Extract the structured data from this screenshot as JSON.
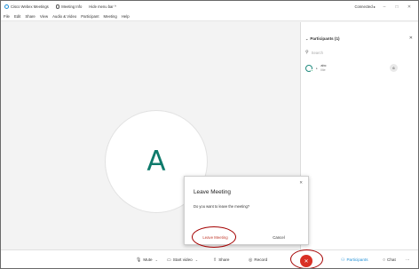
{
  "window": {
    "app_title": "Cisco Webex Meetings",
    "meeting_info": "Meeting Info",
    "hide_menu": "Hide menu bar ^",
    "connected": "Connected",
    "connected_caret": "▸"
  },
  "menu": [
    "File",
    "Edit",
    "Share",
    "View",
    "Audio & Video",
    "Participant",
    "Meeting",
    "Help"
  ],
  "stage": {
    "avatar_letter": "A"
  },
  "participants": {
    "header": "Participants (1)",
    "search_placeholder": "Search",
    "items": [
      {
        "name": "abc",
        "sub": "Me",
        "badge": "6"
      }
    ]
  },
  "dialog": {
    "title": "Leave Meeting",
    "message": "Do you want to leave the meeting?",
    "leave_label": "Leave Meeting",
    "cancel_label": "Cancel"
  },
  "toolbar": {
    "mute": "Mute",
    "start_video": "Start video",
    "share": "Share",
    "record": "Record",
    "participants": "Participants",
    "chat": "Chat",
    "more": "···",
    "end_icon": "✕"
  },
  "colors": {
    "end_red": "#d93025",
    "accent_teal": "#0e7a6b",
    "link_blue": "#1f8fd6",
    "annotation_red": "#a40000"
  },
  "icons": [
    "webex-logo-icon",
    "info-icon",
    "minimize-icon",
    "maximize-icon",
    "close-icon",
    "search-icon",
    "mic-icon",
    "video-icon",
    "share-icon",
    "record-icon",
    "participants-icon",
    "chat-icon",
    "more-icon",
    "end-call-icon"
  ]
}
